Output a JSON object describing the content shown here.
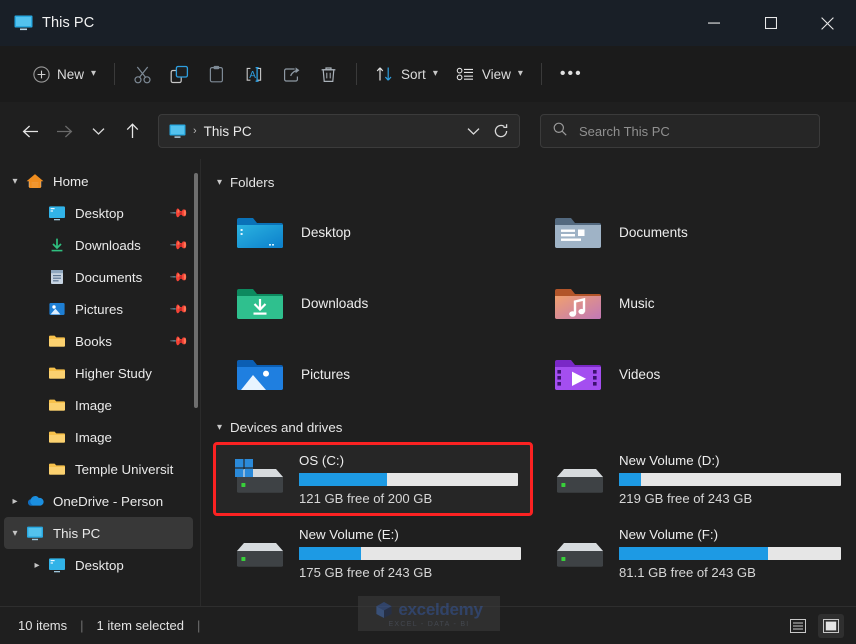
{
  "window": {
    "title": "This PC",
    "title_icon": "this-pc-monitor-icon",
    "controls": {
      "minimize": "—",
      "maximize": "☐",
      "close": "✕"
    }
  },
  "toolbar": {
    "new_label": "New",
    "sort_label": "Sort",
    "view_label": "View",
    "more_label": "•••",
    "items": [
      {
        "name": "cut-icon"
      },
      {
        "name": "copy-icon"
      },
      {
        "name": "paste-icon"
      },
      {
        "name": "rename-icon"
      },
      {
        "name": "share-icon"
      },
      {
        "name": "delete-icon"
      }
    ]
  },
  "navigation": {
    "back": "←",
    "forward": "→",
    "recent": "⌄",
    "up": "↑",
    "refresh": "⟳",
    "dropdown": "⌄"
  },
  "address": {
    "icon": "this-pc-monitor-icon",
    "separator": "›",
    "path": "This PC"
  },
  "search": {
    "icon": "search-icon",
    "placeholder": "Search This PC",
    "value": ""
  },
  "sidebar": {
    "items": [
      {
        "label": "Home",
        "icon": "home-icon",
        "chevron": "down",
        "indent": 0,
        "pinned": false,
        "selected": false
      },
      {
        "label": "Desktop",
        "icon": "desktop-icon",
        "chevron": "none",
        "indent": 1,
        "pinned": true,
        "selected": false
      },
      {
        "label": "Downloads",
        "icon": "downloads-icon",
        "chevron": "none",
        "indent": 1,
        "pinned": true,
        "selected": false
      },
      {
        "label": "Documents",
        "icon": "documents-icon",
        "chevron": "none",
        "indent": 1,
        "pinned": true,
        "selected": false
      },
      {
        "label": "Pictures",
        "icon": "pictures-icon",
        "chevron": "none",
        "indent": 1,
        "pinned": true,
        "selected": false
      },
      {
        "label": "Books",
        "icon": "folder-icon",
        "chevron": "none",
        "indent": 1,
        "pinned": true,
        "selected": false
      },
      {
        "label": "Higher Study",
        "icon": "folder-icon",
        "chevron": "none",
        "indent": 1,
        "pinned": false,
        "selected": false
      },
      {
        "label": "Image",
        "icon": "folder-icon",
        "chevron": "none",
        "indent": 1,
        "pinned": false,
        "selected": false
      },
      {
        "label": "Image",
        "icon": "folder-icon",
        "chevron": "none",
        "indent": 1,
        "pinned": false,
        "selected": false
      },
      {
        "label": "Temple Universit",
        "icon": "folder-icon",
        "chevron": "none",
        "indent": 1,
        "pinned": false,
        "selected": false
      },
      {
        "label": "OneDrive - Person",
        "icon": "onedrive-icon",
        "chevron": "right",
        "indent": 0,
        "pinned": false,
        "selected": false
      },
      {
        "label": "This PC",
        "icon": "this-pc-icon",
        "chevron": "down",
        "indent": 0,
        "pinned": false,
        "selected": true
      },
      {
        "label": "Desktop",
        "icon": "desktop-icon",
        "chevron": "right",
        "indent": 1,
        "pinned": false,
        "selected": false
      }
    ]
  },
  "content": {
    "folders_group": {
      "label": "Folders",
      "expanded": true
    },
    "folders": [
      {
        "name": "Desktop",
        "icon": "desktop-folder-icon"
      },
      {
        "name": "Documents",
        "icon": "documents-folder-icon"
      },
      {
        "name": "Downloads",
        "icon": "downloads-folder-icon"
      },
      {
        "name": "Music",
        "icon": "music-folder-icon"
      },
      {
        "name": "Pictures",
        "icon": "pictures-folder-icon"
      },
      {
        "name": "Videos",
        "icon": "videos-folder-icon"
      }
    ],
    "drives_group": {
      "label": "Devices and drives",
      "expanded": true
    },
    "drives": [
      {
        "name": "OS (C:)",
        "free_text": "121 GB free of 200 GB",
        "used_percent": 40,
        "free_gb": 121,
        "total_gb": 200,
        "is_system": true,
        "selected": true,
        "annotated": true
      },
      {
        "name": "New Volume (D:)",
        "free_text": "219 GB free of 243 GB",
        "used_percent": 10,
        "free_gb": 219,
        "total_gb": 243,
        "is_system": false,
        "selected": false,
        "annotated": false
      },
      {
        "name": "New Volume (E:)",
        "free_text": "175 GB free of 243 GB",
        "used_percent": 28,
        "free_gb": 175,
        "total_gb": 243,
        "is_system": false,
        "selected": false,
        "annotated": false
      },
      {
        "name": "New Volume (F:)",
        "free_text": "81.1 GB free of 243 GB",
        "used_percent": 67,
        "free_gb": 81.1,
        "total_gb": 243,
        "is_system": false,
        "selected": false,
        "annotated": false
      }
    ]
  },
  "statusbar": {
    "item_count": "10 items",
    "divider": "|",
    "selection": "1 item selected",
    "trailing_divider": "|",
    "views": [
      {
        "name": "details-view-button",
        "active": false
      },
      {
        "name": "large-icons-view-button",
        "active": true
      }
    ]
  },
  "watermark": {
    "word": "exceldemy",
    "tagline": "EXCEL - DATA - BI"
  },
  "colors": {
    "accent_blue": "#1d9ae4",
    "annotation_red": "#fb2222",
    "titlebar_bg": "#191f27",
    "window_bg": "#1f1f1f",
    "bar_track": "#e6e6e6"
  }
}
